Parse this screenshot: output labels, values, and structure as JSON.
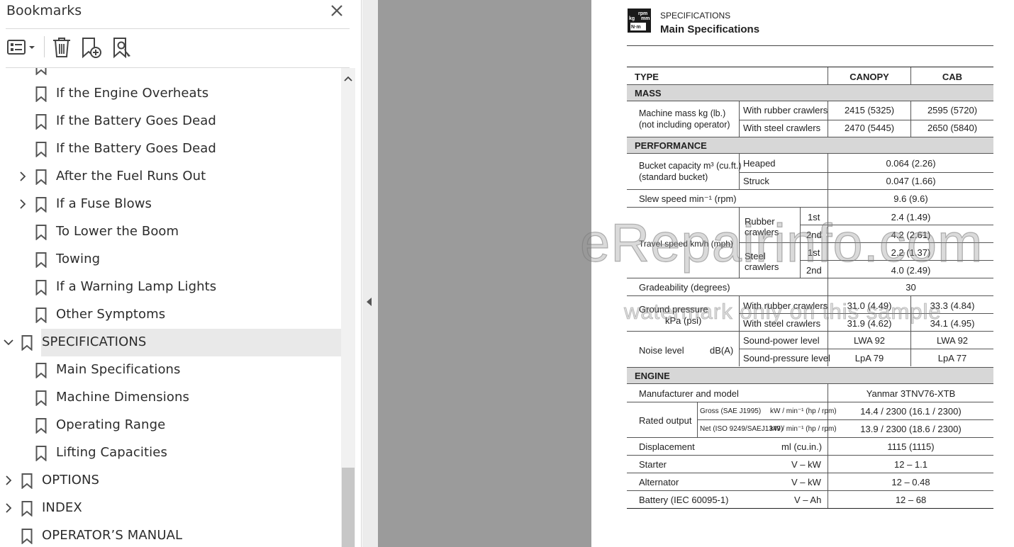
{
  "panel": {
    "title": "Bookmarks",
    "toolbar": {
      "options_icon": "list-options-icon",
      "delete_icon": "trash-icon",
      "new_icon": "bookmark-add-icon",
      "find_icon": "bookmark-find-icon"
    }
  },
  "tree": [
    {
      "label": "If the Engine Overheats",
      "level": 2,
      "expander": "none"
    },
    {
      "label": "If the Battery Goes Dead",
      "level": 2,
      "expander": "none"
    },
    {
      "label": "If the Battery Goes Dead",
      "level": 2,
      "expander": "none"
    },
    {
      "label": "After the Fuel Runs Out",
      "level": 2,
      "expander": "collapsed"
    },
    {
      "label": "If a Fuse Blows",
      "level": 2,
      "expander": "collapsed"
    },
    {
      "label": "To Lower the Boom",
      "level": 2,
      "expander": "none"
    },
    {
      "label": "Towing",
      "level": 2,
      "expander": "none"
    },
    {
      "label": "If a Warning Lamp Lights",
      "level": 2,
      "expander": "none"
    },
    {
      "label": "Other Symptoms",
      "level": 2,
      "expander": "none"
    },
    {
      "label": "SPECIFICATIONS",
      "level": 1,
      "expander": "expanded",
      "selected": true
    },
    {
      "label": "Main Specifications",
      "level": 2,
      "expander": "none"
    },
    {
      "label": "Machine Dimensions",
      "level": 2,
      "expander": "none"
    },
    {
      "label": "Operating Range",
      "level": 2,
      "expander": "none"
    },
    {
      "label": "Lifting Capacities",
      "level": 2,
      "expander": "none"
    },
    {
      "label": "OPTIONS",
      "level": 1,
      "expander": "collapsed"
    },
    {
      "label": "INDEX",
      "level": 1,
      "expander": "collapsed"
    },
    {
      "label": "OPERATOR’S MANUAL",
      "level": 1,
      "expander": "none"
    }
  ],
  "doc": {
    "logo_text": [
      "rpm",
      "kg",
      "mm",
      "N·m"
    ],
    "section": "SPECIFICATIONS",
    "heading": "Main Specifications",
    "table": {
      "type": "TYPE",
      "canopy": "CANOPY",
      "cab": "CAB",
      "mass": "MASS",
      "machine_mass_1": "Machine mass  kg (lb.)",
      "machine_mass_2": "(not including operator)",
      "rubber_crawlers": "With rubber crawlers",
      "steel_crawlers": "With steel crawlers",
      "mass_rubber_canopy": "2415 (5325)",
      "mass_rubber_cab": "2595 (5720)",
      "mass_steel_canopy": "2470 (5445)",
      "mass_steel_cab": "2650 (5840)",
      "performance": "PERFORMANCE",
      "bucket_1": "Bucket capacity m³ (cu.ft.)",
      "bucket_2": "(standard bucket)",
      "heaped": "Heaped",
      "struck": "Struck",
      "heaped_val": "0.064 (2.26)",
      "struck_val": "0.047 (1.66)",
      "slew": "Slew speed  min⁻¹ (rpm)",
      "slew_val": "9.6 (9.6)",
      "travel": "Travel speed km/h (mph)",
      "rubber_1": "Rubber",
      "rubber_2": "crawlers",
      "steel_1": "Steel",
      "steel_2": "crawlers",
      "first": "1st",
      "second": "2nd",
      "tr_rubber_1": "2.4 (1.49)",
      "tr_rubber_2": "4.2 (2.61)",
      "tr_steel_1": "2.2 (1.37)",
      "tr_steel_2": "4.0 (2.49)",
      "grade": "Gradeability (degrees)",
      "grade_val": "30",
      "ground_1": "Ground pressure",
      "ground_2": "kPa (psi)",
      "gp_rubber_canopy": "31.0 (4.49)",
      "gp_rubber_cab": "33.3 (4.84)",
      "gp_steel_canopy": "31.9 (4.62)",
      "gp_steel_cab": "34.1 (4.95)",
      "noise": "Noise level",
      "noise_unit": "dB(A)",
      "sound_power": "Sound-power level",
      "sound_pressure": "Sound-pressure level",
      "sp_canopy": "LWA 92",
      "sp_cab": "LWA 92",
      "spr_canopy": "LpA 79",
      "spr_cab": "LpA 77",
      "engine": "ENGINE",
      "manufacturer": "Manufacturer and model",
      "manufacturer_val": "Yanmar 3TNV76-XTB",
      "rated": "Rated output",
      "gross": "Gross (SAE J1995)",
      "net": "Net (ISO 9249/SAEJ1349)",
      "rated_unit": "kW / min⁻¹ (hp / rpm)",
      "gross_val": "14.4 / 2300 (16.1 / 2300)",
      "net_val": "13.9 / 2300 (18.6 / 2300)",
      "displacement": "Displacement",
      "displacement_unit": "ml (cu.in.)",
      "displacement_val": "1115 (1115)",
      "starter": "Starter",
      "starter_unit": "V – kW",
      "starter_val": "12 – 1.1",
      "alternator": "Alternator",
      "alternator_unit": "V – kW",
      "alternator_val": "12 – 0.48",
      "battery": "Battery (IEC 60095-1)",
      "battery_unit": "V – Ah",
      "battery_val": "12 – 68"
    }
  },
  "watermark": {
    "line1": "eRepairinfo.com",
    "line2": "watermark only on this sample"
  }
}
